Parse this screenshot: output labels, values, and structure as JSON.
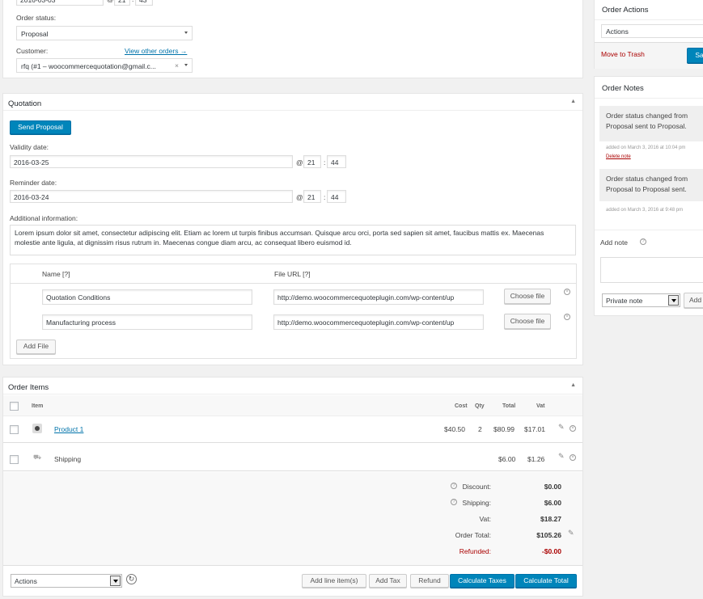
{
  "order_details": {
    "date_value": "2016-03-03",
    "hour": "21",
    "minute": "43",
    "status_label": "Order status:",
    "status_value": "Proposal",
    "customer_label": "Customer:",
    "view_other_orders": "View other orders →",
    "customer_value": "rfq (#1 – woocommercequotation@gmail.c..."
  },
  "quotation": {
    "title": "Quotation",
    "send_button": "Send Proposal",
    "validity_label": "Validity date:",
    "validity_value": "2016-03-25",
    "validity_hour": "21",
    "validity_minute": "44",
    "reminder_label": "Reminder date:",
    "reminder_value": "2016-03-24",
    "reminder_hour": "21",
    "reminder_minute": "44",
    "at_symbol": "@",
    "colon": ":",
    "additional_label": "Additional information:",
    "additional_text": "Lorem ipsum dolor sit amet, consectetur adipiscing elit. Etiam ac lorem ut turpis finibus accumsan. Quisque arcu orci, porta sed sapien sit amet, faucibus mattis ex. Maecenas molestie ante ligula, at dignissim risus rutrum in. Maecenas congue diam arcu, ac consequat libero euismod id.",
    "files_header_name": "Name [?]",
    "files_header_url": "File URL [?]",
    "files": [
      {
        "name": "Quotation Conditions",
        "url": "http://demo.woocommercequoteplugin.com/wp-content/up",
        "choose": "Choose file"
      },
      {
        "name": "Manufacturing process",
        "url": "http://demo.woocommercequoteplugin.com/wp-content/up",
        "choose": "Choose file"
      }
    ],
    "add_file": "Add File"
  },
  "order_items": {
    "title": "Order Items",
    "columns": {
      "item": "Item",
      "cost": "Cost",
      "qty": "Qty",
      "total": "Total",
      "vat": "Vat"
    },
    "product": {
      "name": "Product 1",
      "cost": "$40.50",
      "qty": "2",
      "total": "$80.99",
      "vat": "$17.01"
    },
    "shipping": {
      "name": "Shipping",
      "total": "$6.00",
      "vat": "$1.26"
    },
    "totals": [
      {
        "label": "Discount:",
        "value": "$0.00"
      },
      {
        "label": "Shipping:",
        "value": "$6.00"
      },
      {
        "label": "Vat:",
        "value": "$18.27"
      },
      {
        "label": "Order Total:",
        "value": "$105.26"
      },
      {
        "label": "Refunded:",
        "value": "-$0.00"
      }
    ],
    "actions_select": "Actions",
    "add_line_items": "Add line item(s)",
    "add_tax": "Add Tax",
    "refund": "Refund",
    "calculate_taxes": "Calculate Taxes",
    "calculate_total": "Calculate Total"
  },
  "order_actions": {
    "title": "Order Actions",
    "select_value": "Actions",
    "move_to_trash": "Move to Trash",
    "save_button": "Save"
  },
  "order_notes": {
    "title": "Order Notes",
    "notes": [
      {
        "text": "Order status changed from Proposal sent to Proposal.",
        "meta": "added on March 3, 2016 at 10:04 pm",
        "delete": "Delete note"
      },
      {
        "text": "Order status changed from Proposal to Proposal sent.",
        "meta": "added on March 3, 2016 at 9:48 pm",
        "delete": "Delete note"
      }
    ],
    "add_note_label": "Add note",
    "note_type": "Private note",
    "add_button": "Add"
  },
  "colors": {
    "primary": "#0085ba",
    "link": "#0073aa",
    "danger": "#a00000"
  }
}
